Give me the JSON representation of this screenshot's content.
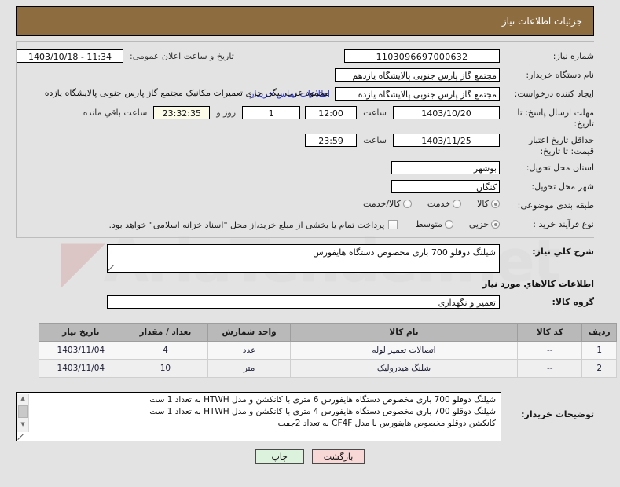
{
  "header": {
    "title": "جزئیات اطلاعات نیاز"
  },
  "watermark": {
    "text": "AriaTender.net"
  },
  "form": {
    "need_number": {
      "label": "شماره نیاز:",
      "value": "1103096697000632"
    },
    "public_announce": {
      "label": "تاریخ و ساعت اعلان عمومی:",
      "value": "1403/10/18 - 11:34"
    },
    "buyer_org": {
      "label": "نام دستگاه خریدار:",
      "value": "مجتمع گاز پارس جنوبی  پالایشگاه یازدهم"
    },
    "creator": {
      "label": "ایجاد کننده درخواست:",
      "value": "مجتمع گاز پارس جنوبی  پالایشگاه یازده",
      "overflow": "محمود عرب بیگی جزی تعمیرات مکانیک مجتمع گاز پارس جنوبی  پالایشگاه یازده",
      "contact_link": "اطلاعات تماس خریدار"
    },
    "reply_deadline": {
      "label": "مهلت ارسال پاسخ: تا تاریخ:",
      "date": "1403/10/20",
      "time_label": "ساعت",
      "time": "12:00",
      "days": "1",
      "days_label": "روز و",
      "countdown": "23:32:35",
      "countdown_label": "ساعت باقي مانده"
    },
    "price_validity": {
      "label": "حداقل تاریخ اعتبار قیمت: تا تاریخ:",
      "date": "1403/11/25",
      "time_label": "ساعت",
      "time": "23:59"
    },
    "delivery_province": {
      "label": "استان محل تحویل:",
      "value": "بوشهر"
    },
    "delivery_city": {
      "label": "شهر محل تحویل:",
      "value": "کنگان"
    },
    "subject_category": {
      "label": "طبقه بندی موضوعی:",
      "options": [
        {
          "label": "کالا",
          "selected": true
        },
        {
          "label": "خدمت",
          "selected": false
        },
        {
          "label": "کالا/خدمت",
          "selected": false
        }
      ]
    },
    "purchase_process": {
      "label": "نوع فرآیند خرید :",
      "options": [
        {
          "label": "جزیی",
          "selected": true
        },
        {
          "label": "متوسط",
          "selected": false
        }
      ],
      "treasury_checkbox": {
        "checked": false,
        "text": "پرداخت تمام یا بخشی از مبلغ خرید،از محل \"اسناد خزانه اسلامی\" خواهد بود."
      }
    }
  },
  "description": {
    "label": "شرح كلي نیاز:",
    "value": "شیلنگ دوقلو 700 باری مخصوص دستگاه هایفورس"
  },
  "goods_section": {
    "subhead": "اطلاعات كالاهاي مورد نیاز",
    "group": {
      "label": "گروه كالا:",
      "value": "تعمیر و نگهداری"
    },
    "table": {
      "columns": [
        "ردیف",
        "کد کالا",
        "نام کالا",
        "واحد شمارش",
        "تعداد / مقدار",
        "تاریخ نیاز"
      ],
      "rows": [
        {
          "radif": "1",
          "code": "--",
          "name": "اتصالات تعمیر لوله",
          "unit": "عدد",
          "qty": "4",
          "date": "1403/11/04"
        },
        {
          "radif": "2",
          "code": "--",
          "name": "شلنگ هیدرولیک",
          "unit": "متر",
          "qty": "10",
          "date": "1403/11/04"
        }
      ]
    }
  },
  "notes": {
    "label": "توضیحات خریدار:",
    "lines": [
      "شیلنگ دوقلو 700 باری مخصوص دستگاه هایفورس 6 متری با کانکشن و مدل HTWH  به تعداد 1 ست",
      "شیلنگ دوقلو 700 باری مخصوص دستگاه هایفورس 4 متری با کانکشن و مدل HTWH  به تعداد 1 ست",
      "کانکشن دوقلو مخصوص هایفورس با مدل CF4F به تعداد 2جفت"
    ],
    "scroll_up_icon": "▲",
    "scroll_down_icon": "▼"
  },
  "footer": {
    "back_label": "بازگشت",
    "print_label": "چاپ"
  },
  "colors": {
    "header_bg": "#8d6c40",
    "page_bg": "#e3e3e3",
    "link": "#2b33c9",
    "table_header_bg": "#b9b9b9",
    "countdown_bg": "#fbfbe8",
    "back_btn_bg": "#f8d7d7",
    "print_btn_bg": "#ddf2dd"
  }
}
